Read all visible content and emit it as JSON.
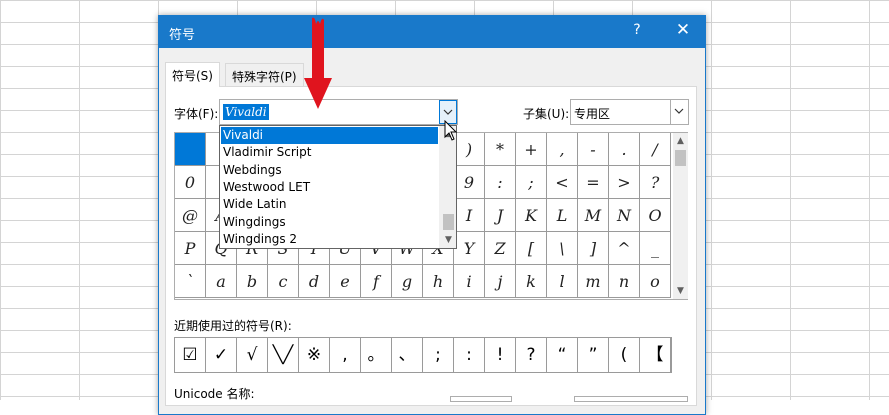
{
  "dialog": {
    "title": "符号",
    "help": "?",
    "close": "✕"
  },
  "tabs": [
    {
      "label": "符号(S)"
    },
    {
      "label": "特殊字符(P)"
    }
  ],
  "font": {
    "label": "字体(F):",
    "value": "Vivaldi"
  },
  "subset": {
    "label": "子集(U):",
    "value": "专用区"
  },
  "font_dropdown": {
    "items": [
      "Vivaldi",
      "Vladimir Script",
      "Webdings",
      "Westwood LET",
      "Wide Latin",
      "Wingdings",
      "Wingdings 2"
    ],
    "selected_index": 0
  },
  "symbol_grid": {
    "rows": [
      [
        "",
        "",
        "",
        "",
        "",
        "",
        "",
        "",
        "",
        ")",
        "*",
        "+",
        ",",
        "-",
        ".",
        "/"
      ],
      [
        "0",
        "",
        "",
        "",
        "",
        "",
        "",
        "",
        "",
        "9",
        ":",
        ";",
        "<",
        "=",
        ">",
        "?"
      ],
      [
        "@",
        "A",
        "",
        "",
        "",
        "",
        "",
        "",
        "",
        "I",
        "J",
        "K",
        "L",
        "M",
        "N",
        "O"
      ],
      [
        "P",
        "Q",
        "R",
        "S",
        "T",
        "U",
        "V",
        "W",
        "X",
        "Y",
        "Z",
        "[",
        "\\",
        "]",
        "^",
        "_"
      ],
      [
        "`",
        "a",
        "b",
        "c",
        "d",
        "e",
        "f",
        "g",
        "h",
        "i",
        "j",
        "k",
        "l",
        "m",
        "n",
        "o"
      ]
    ]
  },
  "recent": {
    "label": "近期使用过的符号(R):",
    "symbols": [
      "☑",
      "✓",
      "√",
      "╲╱",
      "※",
      ",",
      "。",
      "、",
      ";",
      ":",
      "!",
      "?",
      "“",
      "”",
      "(",
      "【"
    ]
  },
  "unicode": {
    "label": "Unicode 名称:"
  },
  "colors": {
    "accent": "#1979ca",
    "selection": "#0078d7",
    "arrow": "#e0141e"
  }
}
